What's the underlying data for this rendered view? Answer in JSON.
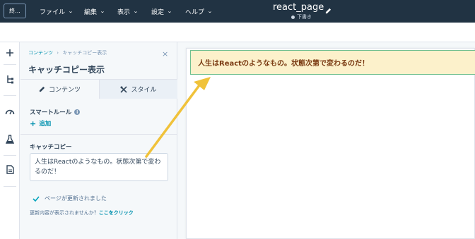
{
  "topbar": {
    "exit_label": "終...",
    "menus": [
      {
        "label": "ファイル"
      },
      {
        "label": "編集"
      },
      {
        "label": "表示"
      },
      {
        "label": "設定"
      },
      {
        "label": "ヘルプ"
      }
    ],
    "page_title": "react_page",
    "status": "下書き",
    "edit_icon": "pencil-icon"
  },
  "rail": {
    "icons": [
      "plus-icon",
      "tree-icon",
      "gauge-icon",
      "flask-icon",
      "document-icon"
    ]
  },
  "panel": {
    "breadcrumb_root": "コンテンツ",
    "breadcrumb_sep": "›",
    "breadcrumb_current": "キャッチコピー表示",
    "close_label": "×",
    "title": "キャッチコピー表示",
    "tabs": [
      {
        "label": "コンテンツ",
        "icon": "pencil-icon"
      },
      {
        "label": "スタイル",
        "icon": "tools-icon"
      }
    ],
    "smart_rule_label": "スマートルール",
    "add_label": "追加",
    "catch_label": "キャッチコピー",
    "catch_value": "人生はReactのようなもの。状態次第で変わるのだ！",
    "updated_message": "ページが更新されました",
    "refresh_prompt": "更新内容が表示されませんか？",
    "refresh_link": "ここをクリック"
  },
  "canvas": {
    "banner_text": "人生はReactのようなもの。状態次第で変わるのだ！"
  },
  "colors": {
    "topbar": "#213343",
    "accent": "#0091ae",
    "banner_bg": "#fcf1cb",
    "banner_text": "#7a3a12",
    "arrow": "#f0c23a"
  }
}
